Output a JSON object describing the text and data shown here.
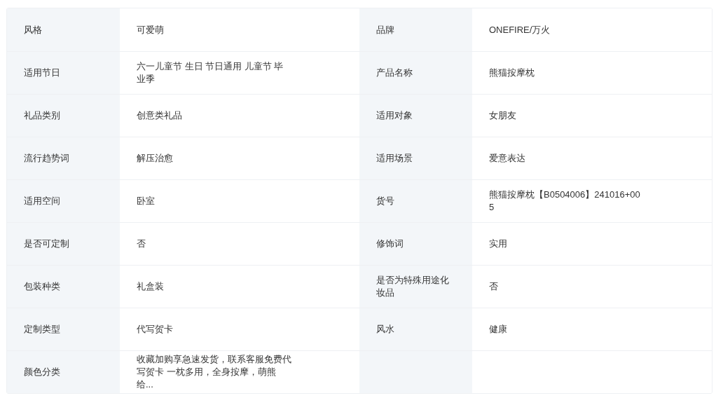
{
  "rows": [
    {
      "cells": [
        {
          "label": "风格",
          "value": "可爱萌"
        },
        {
          "label": "品牌",
          "value": "ONEFIRE/万火"
        }
      ]
    },
    {
      "cells": [
        {
          "label": "适用节日",
          "value": "六一儿童节 生日 节日通用 儿童节 毕业季"
        },
        {
          "label": "产品名称",
          "value": "熊猫按摩枕"
        }
      ]
    },
    {
      "cells": [
        {
          "label": "礼品类别",
          "value": "创意类礼品"
        },
        {
          "label": "适用对象",
          "value": "女朋友"
        }
      ]
    },
    {
      "cells": [
        {
          "label": "流行趋势词",
          "value": "解压治愈"
        },
        {
          "label": "适用场景",
          "value": "爱意表达"
        }
      ]
    },
    {
      "cells": [
        {
          "label": "适用空间",
          "value": "卧室"
        },
        {
          "label": "货号",
          "value": "熊猫按摩枕【B0504006】241016+005"
        }
      ]
    },
    {
      "cells": [
        {
          "label": "是否可定制",
          "value": "否"
        },
        {
          "label": "修饰词",
          "value": "实用"
        }
      ]
    },
    {
      "cells": [
        {
          "label": "包装种类",
          "value": "礼盒装"
        },
        {
          "label": "是否为特殊用途化妆品",
          "value": "否"
        }
      ]
    },
    {
      "cells": [
        {
          "label": "定制类型",
          "value": "代写贺卡"
        },
        {
          "label": "风水",
          "value": "健康"
        }
      ]
    },
    {
      "cells": [
        {
          "label": "颜色分类",
          "value": "收藏加购享急速发货，联系客服免费代写贺卡 一枕多用，全身按摩，萌熊给..."
        }
      ]
    }
  ]
}
